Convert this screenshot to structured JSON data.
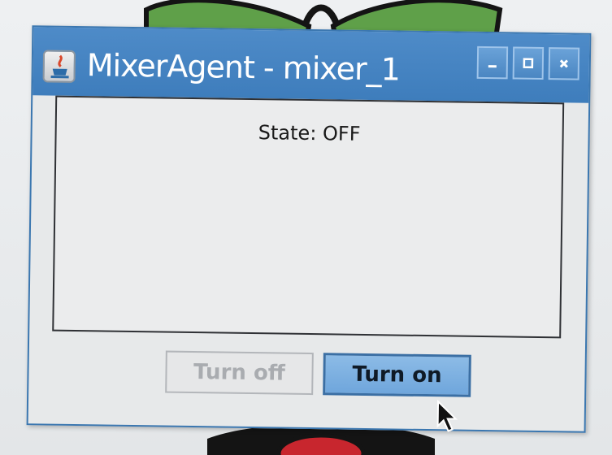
{
  "window": {
    "title": "MixerAgent - mixer_1",
    "controls": {
      "minimize_icon": "minimize-icon",
      "maximize_icon": "maximize-icon",
      "close_icon": "close-icon"
    }
  },
  "main": {
    "state_text": "State: OFF"
  },
  "buttons": {
    "turn_off": "Turn off",
    "turn_on": "Turn on"
  },
  "colors": {
    "titlebar": "#3e7dbc",
    "accent_button": "#6fa6dc",
    "disabled_text": "#a9acb0"
  }
}
